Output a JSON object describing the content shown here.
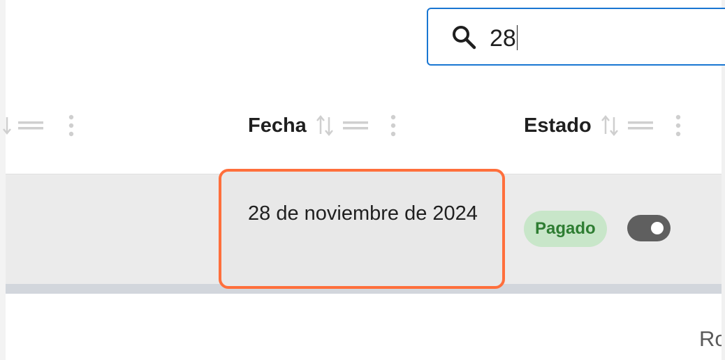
{
  "search": {
    "value": "28",
    "icon": "search-icon"
  },
  "table": {
    "columns": [
      {
        "label": "",
        "icons": [
          "sort-icon",
          "drag-handle-icon",
          "more-vert-icon"
        ]
      },
      {
        "label": "Fecha",
        "icons": [
          "sort-icon",
          "drag-handle-icon",
          "more-vert-icon"
        ]
      },
      {
        "label": "Estado",
        "icons": [
          "sort-icon",
          "drag-handle-icon",
          "more-vert-icon"
        ]
      }
    ],
    "rows": [
      {
        "fecha": "28 de noviembre de 2024",
        "estado": "Pagado",
        "toggle_on": true
      }
    ]
  },
  "footer": {
    "text": "Ro"
  },
  "colors": {
    "accent": "#1976d2",
    "highlight": "#ff6f3c",
    "badge_bg": "#c8e6c9",
    "badge_text": "#2e7d32",
    "toggle": "#5f5f5f"
  }
}
